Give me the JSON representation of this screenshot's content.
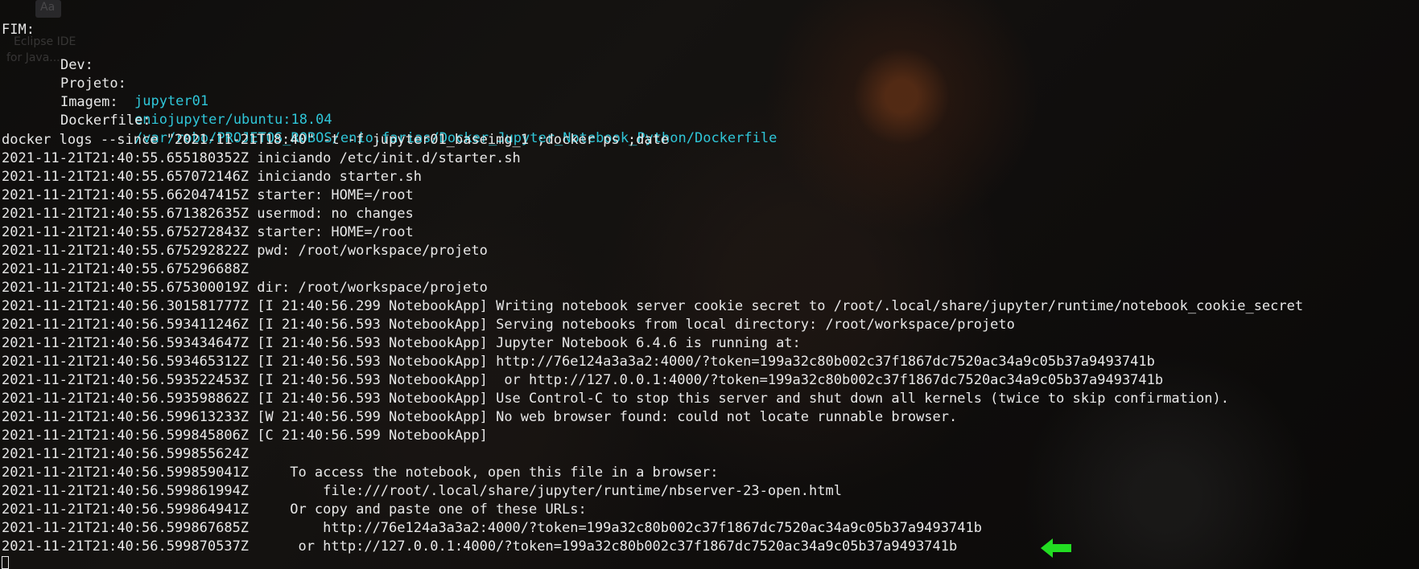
{
  "background_ghost": {
    "tile_text": "Aa",
    "lines": [
      "Eclipse IDE",
      "for Java..."
    ]
  },
  "header": {
    "fim": "FIM:",
    "dev_label": "Dev:",
    "projeto_label": "Projeto:",
    "projeto_value": "jupyter01",
    "imagem_label": "Imagem:",
    "imagem_value": "eniojupyter/ubuntu:18.04",
    "dockerfile_label": "Dockerfile:",
    "dockerfile_value": "/var/robo/PROJETOS_ROBOS/enio.farias/Docker_Jupyter_Notebook_Python/Dockerfile"
  },
  "command": "docker logs --since \"2021-11-21T18:40\" -t -f jupyter01_baseimg_1 ;docker ps ;date",
  "log_lines": [
    "2021-11-21T21:40:55.655180352Z iniciando /etc/init.d/starter.sh",
    "2021-11-21T21:40:55.657072146Z iniciando starter.sh",
    "2021-11-21T21:40:55.662047415Z starter: HOME=/root",
    "2021-11-21T21:40:55.671382635Z usermod: no changes",
    "2021-11-21T21:40:55.675272843Z starter: HOME=/root",
    "2021-11-21T21:40:55.675292822Z pwd: /root/workspace/projeto",
    "2021-11-21T21:40:55.675296688Z",
    "2021-11-21T21:40:55.675300019Z dir: /root/workspace/projeto",
    "2021-11-21T21:40:56.301581777Z [I 21:40:56.299 NotebookApp] Writing notebook server cookie secret to /root/.local/share/jupyter/runtime/notebook_cookie_secret",
    "2021-11-21T21:40:56.593411246Z [I 21:40:56.593 NotebookApp] Serving notebooks from local directory: /root/workspace/projeto",
    "2021-11-21T21:40:56.593434647Z [I 21:40:56.593 NotebookApp] Jupyter Notebook 6.4.6 is running at:",
    "2021-11-21T21:40:56.593465312Z [I 21:40:56.593 NotebookApp] http://76e124a3a3a2:4000/?token=199a32c80b002c37f1867dc7520ac34a9c05b37a9493741b",
    "2021-11-21T21:40:56.593522453Z [I 21:40:56.593 NotebookApp]  or http://127.0.0.1:4000/?token=199a32c80b002c37f1867dc7520ac34a9c05b37a9493741b",
    "2021-11-21T21:40:56.593598862Z [I 21:40:56.593 NotebookApp] Use Control-C to stop this server and shut down all kernels (twice to skip confirmation).",
    "2021-11-21T21:40:56.599613233Z [W 21:40:56.599 NotebookApp] No web browser found: could not locate runnable browser.",
    "2021-11-21T21:40:56.599845806Z [C 21:40:56.599 NotebookApp]",
    "2021-11-21T21:40:56.599855624Z",
    "2021-11-21T21:40:56.599859041Z     To access the notebook, open this file in a browser:",
    "2021-11-21T21:40:56.599861994Z         file:///root/.local/share/jupyter/runtime/nbserver-23-open.html",
    "2021-11-21T21:40:56.599864941Z     Or copy and paste one of these URLs:",
    "2021-11-21T21:40:56.599867685Z         http://76e124a3a3a2:4000/?token=199a32c80b002c37f1867dc7520ac34a9c05b37a9493741b",
    "2021-11-21T21:40:56.599870537Z      or http://127.0.0.1:4000/?token=199a32c80b002c37f1867dc7520ac34a9c05b37a9493741b"
  ],
  "colors": {
    "text": "#e8e8e8",
    "value": "#2fc6d8",
    "arrow": "#22dd22"
  },
  "icons": {
    "pointer": "green-arrow-icon",
    "cursor": "terminal-cursor"
  }
}
